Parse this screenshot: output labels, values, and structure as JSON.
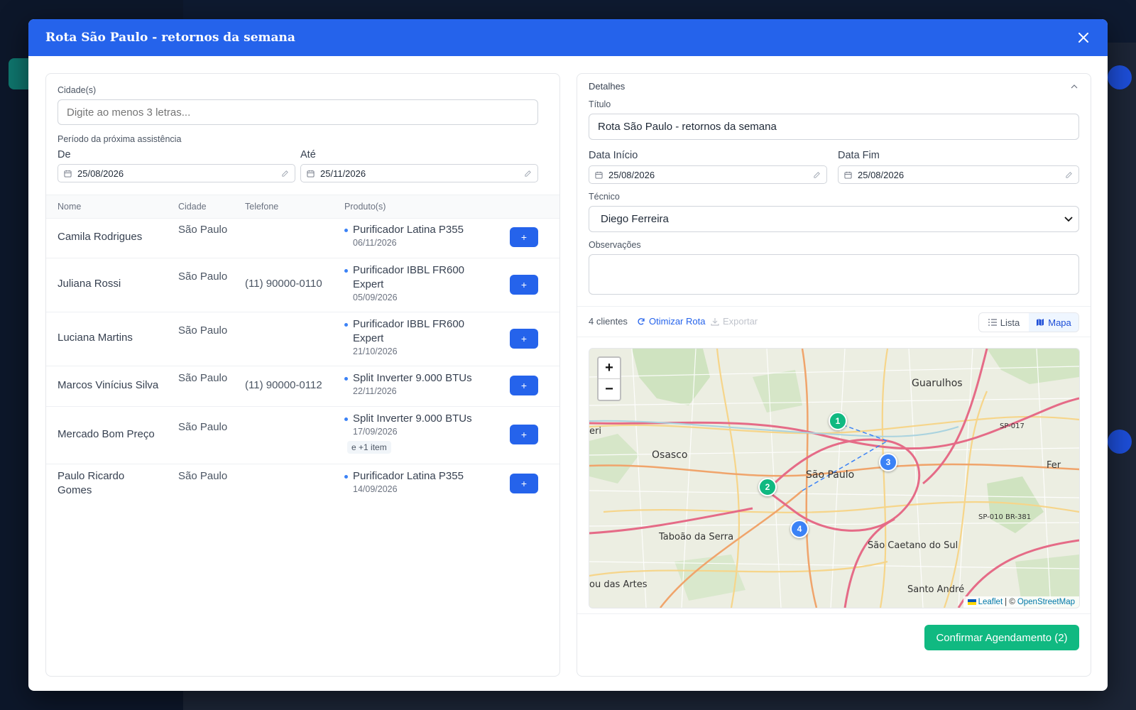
{
  "modal": {
    "title": "Rota São Paulo - retornos da semana"
  },
  "filters": {
    "city_label": "Cidade(s)",
    "city_placeholder": "Digite ao menos 3 letras...",
    "period_label": "Período da próxima assistência",
    "from_label": "De",
    "from_value": "25/08/2026",
    "to_label": "Até",
    "to_value": "25/11/2026"
  },
  "table": {
    "headers": [
      "Nome",
      "Cidade",
      "Telefone",
      "Produto(s)"
    ],
    "rows": [
      {
        "name": "Camila Rodrigues",
        "city": "São Paulo",
        "phone": "",
        "product": "Purificador Latina P355",
        "date": "06/11/2026",
        "extra": ""
      },
      {
        "name": "Juliana Rossi",
        "city": "São Paulo",
        "phone": "(11) 90000-0110",
        "product": "Purificador IBBL FR600 Expert",
        "date": "05/09/2026",
        "extra": ""
      },
      {
        "name": "Luciana Martins",
        "city": "São Paulo",
        "phone": "",
        "product": "Purificador IBBL FR600 Expert",
        "date": "21/10/2026",
        "extra": ""
      },
      {
        "name": "Marcos Vinícius Silva",
        "city": "São Paulo",
        "phone": "(11) 90000-0112",
        "product": "Split Inverter 9.000 BTUs",
        "date": "22/11/2026",
        "extra": ""
      },
      {
        "name": "Mercado Bom Preço",
        "city": "São Paulo",
        "phone": "",
        "product": "Split Inverter 9.000 BTUs",
        "date": "17/09/2026",
        "extra": "e +1 item"
      },
      {
        "name": "Paulo Ricardo Gomes",
        "city": "São Paulo",
        "phone": "",
        "product": "Purificador Latina P355",
        "date": "14/09/2026",
        "extra": ""
      }
    ],
    "add_label": "+"
  },
  "details": {
    "section_label": "Detalhes",
    "title_label": "Título",
    "title_value": "Rota São Paulo - retornos da semana",
    "start_label": "Data Início",
    "start_value": "25/08/2026",
    "end_label": "Data Fim",
    "end_value": "25/08/2026",
    "tech_label": "Técnico",
    "tech_value": "Diego Ferreira",
    "notes_label": "Observações",
    "notes_value": ""
  },
  "route": {
    "count_text": "4 clientes",
    "optimize_label": "Otimizar Rota",
    "export_label": "Exportar",
    "view_list": "Lista",
    "view_map": "Mapa",
    "active_view": "Mapa"
  },
  "map": {
    "zoom_in": "+",
    "zoom_out": "−",
    "places": [
      "Guarulhos",
      "Osasco",
      "São Paulo",
      "Taboão da Serra",
      "São Caetano do Sul",
      "Santo André",
      "Fer",
      "eri",
      "ou das Artes",
      "SP-017",
      "SP-010 BR-381"
    ],
    "markers": [
      {
        "label": "1",
        "color": "#10b981"
      },
      {
        "label": "2",
        "color": "#10b981"
      },
      {
        "label": "3",
        "color": "#3b82f6"
      },
      {
        "label": "4",
        "color": "#3b82f6"
      }
    ],
    "attribution_leaflet": "Leaflet",
    "attribution_sep": "| ©",
    "attribution_osm": "OpenStreetMap"
  },
  "footer": {
    "confirm_label": "Confirmar Agendamento (2)"
  },
  "colors": {
    "primary": "#2563eb",
    "success": "#10b981"
  }
}
